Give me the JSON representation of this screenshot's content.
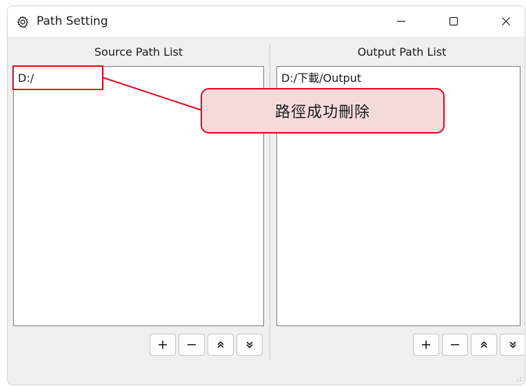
{
  "window": {
    "title": "Path Setting",
    "icon": "gear-icon"
  },
  "source": {
    "title": "Source Path List",
    "items": [
      "D:/"
    ],
    "buttons": {
      "add": "+",
      "remove": "−",
      "up": "⌃⌃",
      "down": "⌄⌄"
    }
  },
  "output": {
    "title": "Output Path List",
    "items": [
      "D:/下載/Output"
    ],
    "buttons": {
      "add": "+",
      "remove": "−",
      "up": "⌃⌃",
      "down": "⌄⌄"
    }
  },
  "annotation": {
    "callout_text": "路徑成功刪除",
    "accent_color": "#e3001b",
    "fill_color": "#f6dada"
  }
}
